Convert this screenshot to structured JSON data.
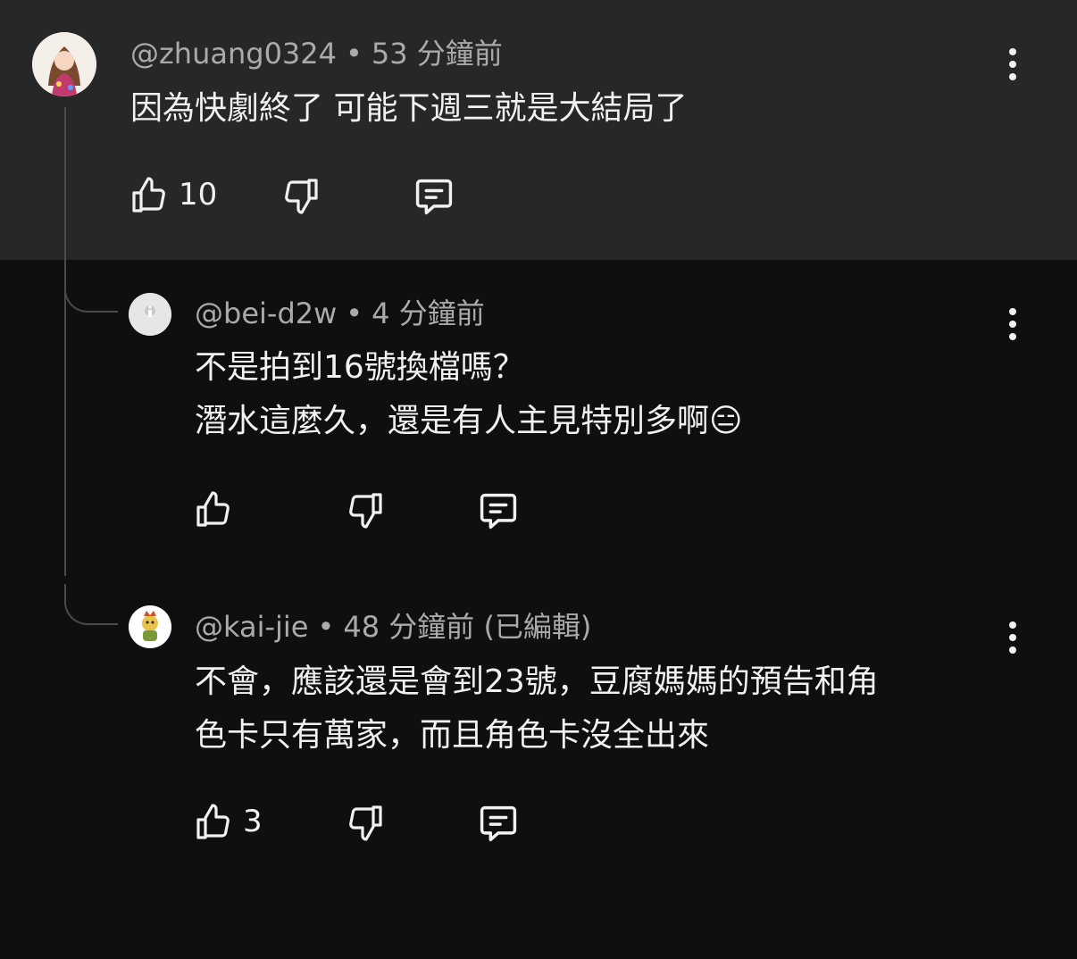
{
  "comments": [
    {
      "author": "@zhuang0324",
      "separator": "•",
      "time": "53 分鐘前",
      "edited": "",
      "lines": [
        "因為快劇終了 可能下週三就是大結局了"
      ],
      "like_count": "10",
      "avatar_icon": "anime-girl-avatar"
    },
    {
      "author": "@bei-d2w",
      "separator": "•",
      "time": "4 分鐘前",
      "edited": "",
      "lines": [
        "不是拍到16號換檔嗎？",
        "潛水這麼久，還是有人主見特別多啊😑"
      ],
      "like_count": "",
      "avatar_icon": "default-gray-avatar"
    },
    {
      "author": "@kai-jie",
      "separator": "•",
      "time": "48 分鐘前",
      "edited": "(已編輯)",
      "lines": [
        "不會，應該還是會到23號，豆腐媽媽的預告和角",
        "色卡只有萬家，而且角色卡沒全出來"
      ],
      "like_count": "3",
      "avatar_icon": "cartoon-character-avatar"
    }
  ],
  "colors": {
    "background": "#0f0f0f",
    "highlight": "#272727",
    "text": "#f1f1f1",
    "meta": "#aaaaaa",
    "thread_line": "#4a4a4a"
  }
}
